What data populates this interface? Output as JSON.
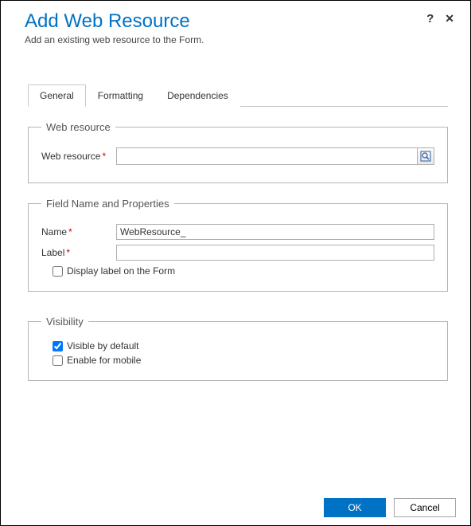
{
  "header": {
    "title": "Add Web Resource",
    "subtitle": "Add an existing web resource to the Form."
  },
  "tabs": [
    {
      "label": "General",
      "active": true
    },
    {
      "label": "Formatting",
      "active": false
    },
    {
      "label": "Dependencies",
      "active": false
    }
  ],
  "groups": {
    "webresource": {
      "legend": "Web resource",
      "label": "Web resource",
      "value": ""
    },
    "fieldprops": {
      "legend": "Field Name and Properties",
      "name_label": "Name",
      "name_value": "WebResource_",
      "label_label": "Label",
      "label_value": "",
      "display_label_checkbox": "Display label on the Form",
      "display_label_checked": false
    },
    "visibility": {
      "legend": "Visibility",
      "visible_label": "Visible by default",
      "visible_checked": true,
      "mobile_label": "Enable for mobile",
      "mobile_checked": false
    }
  },
  "footer": {
    "ok": "OK",
    "cancel": "Cancel"
  }
}
